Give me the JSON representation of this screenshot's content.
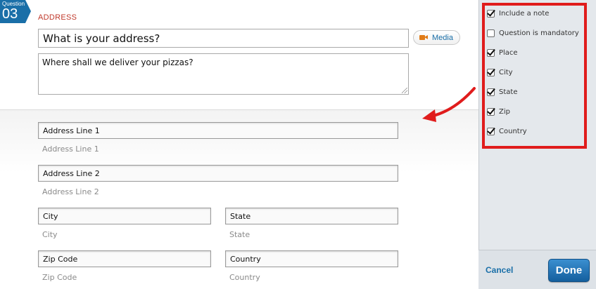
{
  "question": {
    "badge_word": "Question",
    "badge_number": "03",
    "type_label": "ADDRESS",
    "title_value": "What is your address?",
    "description_value": "Where shall we deliver your pizzas?",
    "media_label": "Media"
  },
  "preview": {
    "fields": [
      {
        "label": "Address Line 1",
        "hint": "Address Line 1"
      },
      {
        "label": "Address Line 2",
        "hint": "Address Line 2"
      },
      {
        "label": "City",
        "hint": "City"
      },
      {
        "label": "State",
        "hint": "State"
      },
      {
        "label": "Zip Code",
        "hint": "Zip Code"
      },
      {
        "label": "Country",
        "hint": "Country"
      }
    ]
  },
  "settings": {
    "options": [
      {
        "label": "Include a note",
        "checked": true
      },
      {
        "label": "Question is mandatory",
        "checked": false
      },
      {
        "label": "Place",
        "checked": true
      },
      {
        "label": "City",
        "checked": true
      },
      {
        "label": "State",
        "checked": true
      },
      {
        "label": "Zip",
        "checked": true
      },
      {
        "label": "Country",
        "checked": true
      }
    ],
    "cancel_label": "Cancel",
    "done_label": "Done"
  },
  "colors": {
    "accent": "#1a6fa8",
    "highlight": "#e01c1c",
    "type_label": "#c0392b"
  }
}
